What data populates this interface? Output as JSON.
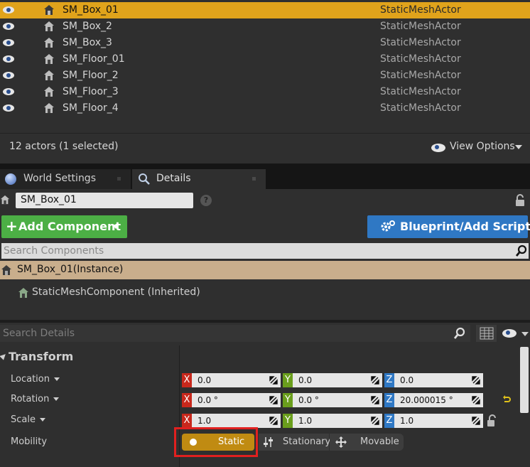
{
  "outliner": {
    "rows": [
      {
        "name": "SM_Box_01",
        "type": "StaticMeshActor",
        "selected": true
      },
      {
        "name": "SM_Box_2",
        "type": "StaticMeshActor"
      },
      {
        "name": "SM_Box_3",
        "type": "StaticMeshActor"
      },
      {
        "name": "SM_Floor_01",
        "type": "StaticMeshActor"
      },
      {
        "name": "SM_Floor_2",
        "type": "StaticMeshActor"
      },
      {
        "name": "SM_Floor_3",
        "type": "StaticMeshActor"
      },
      {
        "name": "SM_Floor_4",
        "type": "StaticMeshActor"
      }
    ],
    "status": "12 actors (1 selected)",
    "view_options": "View Options"
  },
  "tabs": [
    {
      "label": "World Settings",
      "icon": "globe-icon"
    },
    {
      "label": "Details",
      "icon": "magnifier-icon",
      "active": true
    }
  ],
  "details": {
    "actor_name": "SM_Box_01",
    "add_component": "Add Component",
    "blueprint_button": "Blueprint/Add Script",
    "search_components_placeholder": "Search Components",
    "instance_label": "SM_Box_01(Instance)",
    "component_label": "StaticMeshComponent (Inherited)",
    "search_details_placeholder": "Search Details",
    "section": "Transform",
    "location": {
      "label": "Location",
      "x": "0.0",
      "y": "0.0",
      "z": "0.0"
    },
    "rotation": {
      "label": "Rotation",
      "x": "0.0 °",
      "y": "0.0 °",
      "z": "20.000015 °"
    },
    "scale": {
      "label": "Scale",
      "x": "1.0",
      "y": "1.0",
      "z": "1.0"
    },
    "axis": {
      "x": "X",
      "y": "Y",
      "z": "Z"
    },
    "mobility": {
      "label": "Mobility",
      "options": [
        "Static",
        "Stationary",
        "Movable"
      ],
      "selected": "Static"
    }
  },
  "colors": {
    "selection": "#e0a31b",
    "add_component": "#4caf45",
    "blueprint": "#2f78c4",
    "axis_x": "#c8281c",
    "axis_y": "#6a9e1c",
    "axis_z": "#2f78c4",
    "highlight_box": "#e0201f"
  }
}
